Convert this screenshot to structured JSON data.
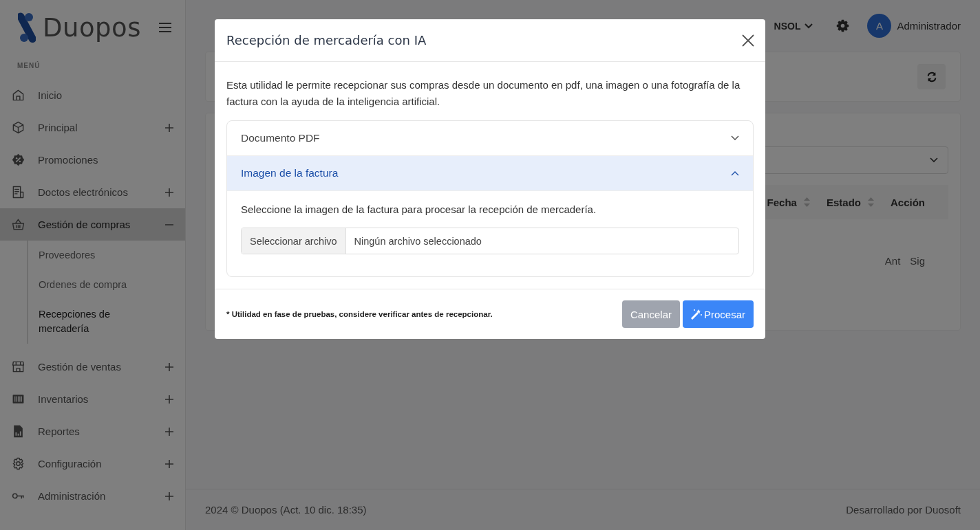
{
  "brand": {
    "name": "Duopos"
  },
  "sidebar": {
    "heading": "MENÚ",
    "items": [
      {
        "label": "Inicio",
        "kind": "home",
        "expandable": false,
        "selected": false
      },
      {
        "label": "Principal",
        "kind": "box",
        "expandable": true,
        "expanded": false,
        "selected": false
      },
      {
        "label": "Promociones",
        "kind": "badge",
        "expandable": false,
        "selected": false
      },
      {
        "label": "Doctos electrónicos",
        "kind": "doc",
        "expandable": true,
        "expanded": false,
        "selected": false
      },
      {
        "label": "Gestión de compras",
        "kind": "basket",
        "expandable": true,
        "expanded": true,
        "selected": true,
        "children": [
          {
            "label": "Proveedores",
            "selected": false
          },
          {
            "label": "Ordenes de compra",
            "selected": false
          },
          {
            "label": "Recepciones de mercadería",
            "selected": true
          }
        ]
      },
      {
        "label": "Gestión de ventas",
        "kind": "store",
        "expandable": true,
        "expanded": false,
        "selected": false
      },
      {
        "label": "Inventarios",
        "kind": "barcode",
        "expandable": true,
        "expanded": false,
        "selected": false
      },
      {
        "label": "Reportes",
        "kind": "report",
        "expandable": true,
        "expanded": false,
        "selected": false
      },
      {
        "label": "Configuración",
        "kind": "gear",
        "expandable": true,
        "expanded": false,
        "selected": false
      },
      {
        "label": "Administración",
        "kind": "key",
        "expandable": true,
        "expanded": false,
        "selected": false
      }
    ]
  },
  "header": {
    "company": "NSOL",
    "user": {
      "initial": "A",
      "name": "Administrador"
    }
  },
  "table": {
    "columns": [
      {
        "label": "Fecha",
        "sortable": true
      },
      {
        "label": "Estado",
        "sortable": true
      },
      {
        "label": "Acción",
        "sortable": false
      }
    ],
    "pagination": [
      "Ant",
      "Sig"
    ]
  },
  "footer": {
    "left": "2024 © Duopos (Act. 10 dic. 18:35)",
    "right": "Desarrollado por Duosoft"
  },
  "modal": {
    "title": "Recepción de mercadería con IA",
    "description": "Esta utilidad le permite recepcionar sus compras desde un documento en pdf, una imagen o una fotografía de la factura con la ayuda de la inteligencia artificial.",
    "accordion": [
      {
        "title": "Documento PDF",
        "expanded": false
      },
      {
        "title": "Imagen de la factura",
        "expanded": true,
        "instruction": "Seleccione la imagen de la factura para procesar la recepción de mercadería.",
        "file_input": {
          "button": "Seleccionar archivo",
          "value": "Ningún archivo seleccionado"
        }
      }
    ],
    "note": "* Utilidad en fase de pruebas, considere verificar antes de recepcionar.",
    "buttons": [
      {
        "label": "Cancelar",
        "kind": "secondary"
      },
      {
        "label": "Procesar",
        "kind": "primary"
      }
    ]
  }
}
